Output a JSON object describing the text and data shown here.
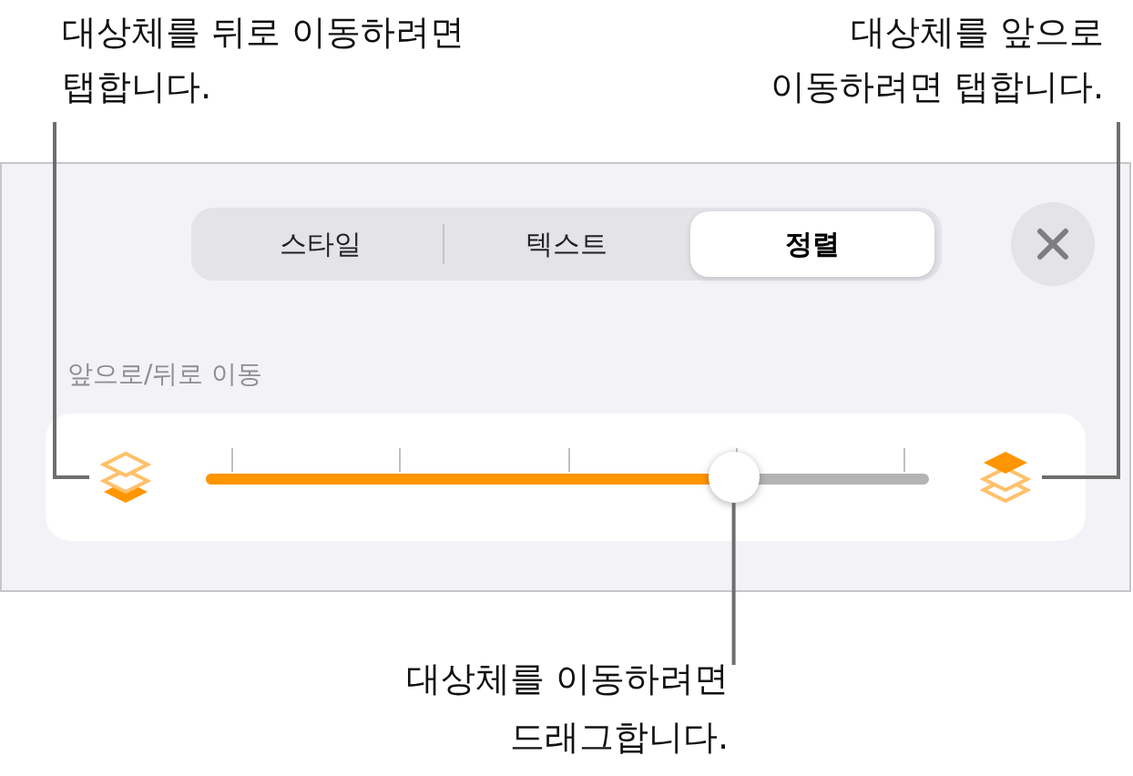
{
  "callouts": [
    {
      "kind": "left",
      "text": "대상체를 뒤로 이동하려면\n탭합니다."
    },
    {
      "kind": "right",
      "text": "대상체를 앞으로\n이동하려면 탭합니다."
    }
  ],
  "tabs": [
    {
      "label": "스타일",
      "selected": false
    },
    {
      "label": "텍스트",
      "selected": false
    },
    {
      "label": "정렬",
      "selected": true
    }
  ],
  "section_label": "앞으로/뒤로 이동",
  "slider": {
    "level": 0.73
  },
  "bottom_callout": "대상체를 이동하려면\n드래그합니다."
}
